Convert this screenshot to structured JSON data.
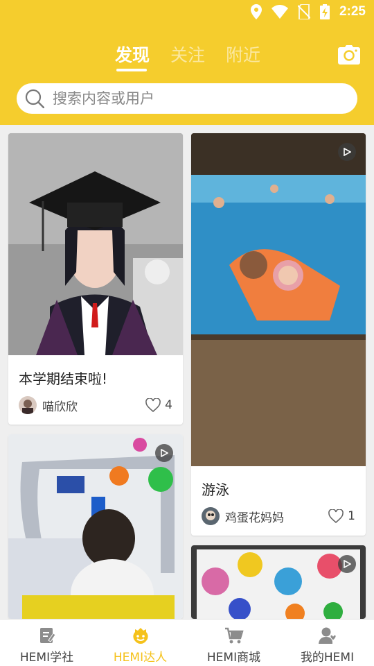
{
  "status_bar": {
    "time": "2:25"
  },
  "header": {
    "tabs": [
      {
        "label": "发现",
        "active": true
      },
      {
        "label": "关注",
        "active": false
      },
      {
        "label": "附近",
        "active": false
      }
    ],
    "camera_icon": "camera-icon"
  },
  "search": {
    "placeholder": "搜索内容或用户"
  },
  "feed": {
    "cards": [
      {
        "title": "本学期结束啦!",
        "author": "喵欣欣",
        "likes": "4",
        "video": false
      },
      {
        "title": "游泳",
        "author": "鸡蛋花妈妈",
        "likes": "1",
        "video": true
      },
      {
        "title": "",
        "author": "",
        "likes": "",
        "video": true
      },
      {
        "title": "",
        "author": "",
        "likes": "",
        "video": true
      }
    ]
  },
  "bottom_nav": {
    "items": [
      {
        "label": "HEMI学社",
        "active": false,
        "icon": "notebook-icon"
      },
      {
        "label": "HEMI达人",
        "active": true,
        "icon": "smiley-icon"
      },
      {
        "label": "HEMI商城",
        "active": false,
        "icon": "cart-icon"
      },
      {
        "label": "我的HEMI",
        "active": false,
        "icon": "user-icon"
      }
    ]
  },
  "colors": {
    "accent": "#f5cd2d",
    "active_nav": "#f5c21b"
  }
}
